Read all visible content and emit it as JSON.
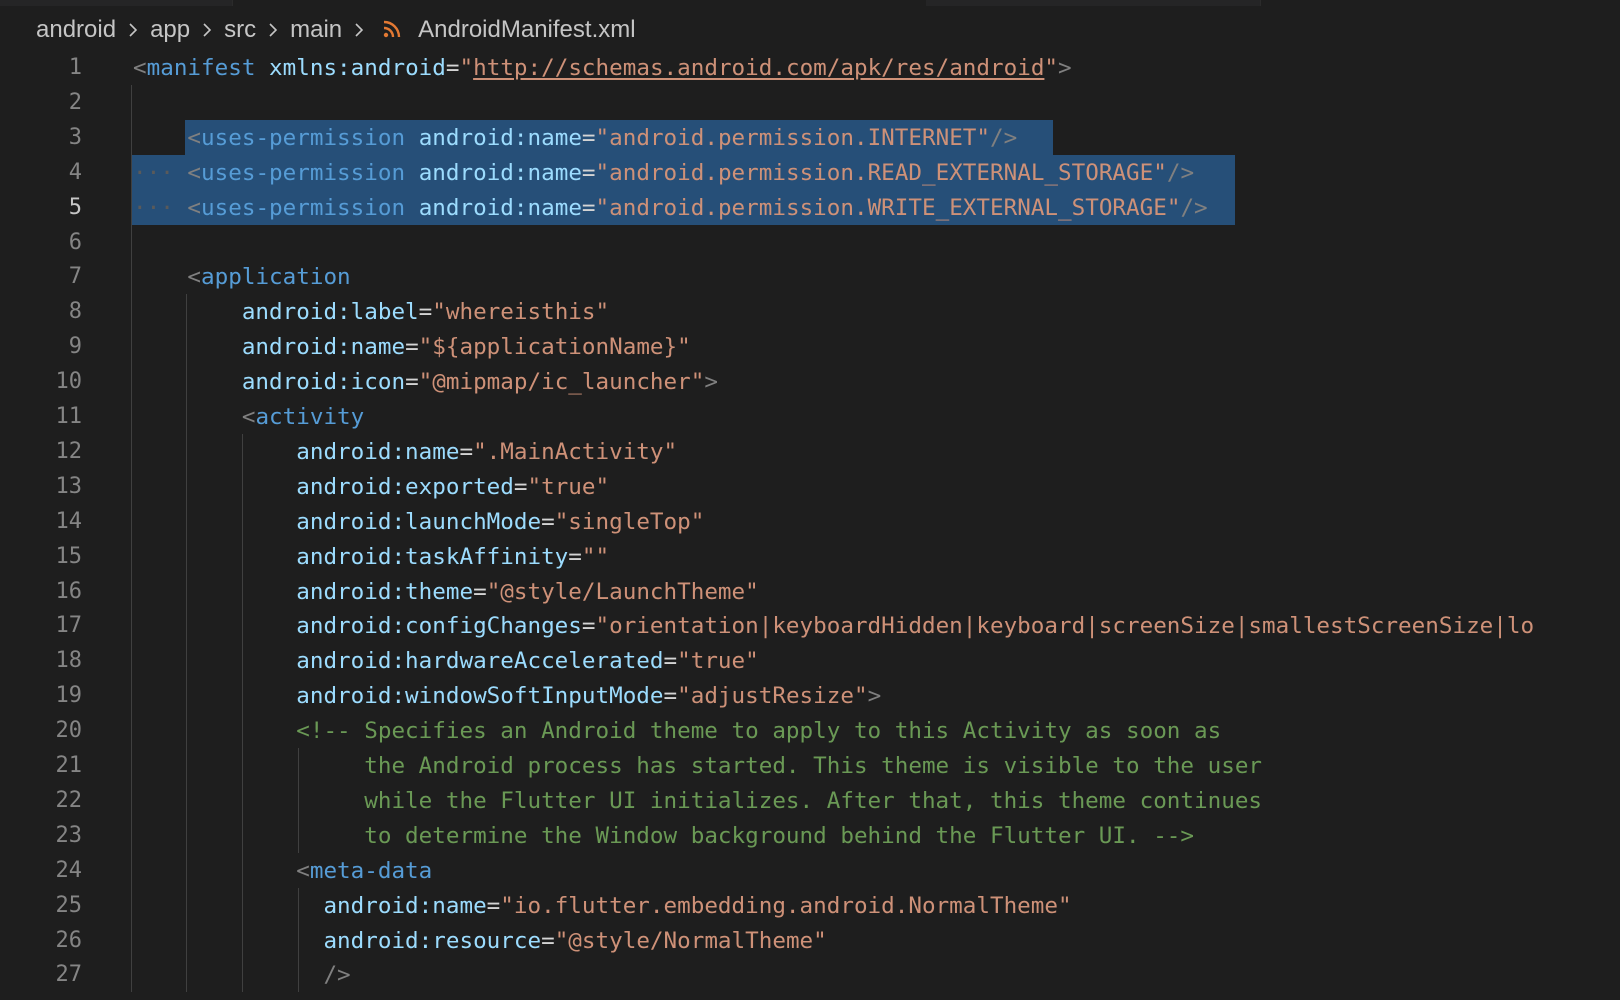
{
  "breadcrumb": {
    "items": [
      "android",
      "app",
      "src",
      "main"
    ],
    "file": "AndroidManifest.xml"
  },
  "editor": {
    "active_line": "5",
    "lines": [
      {
        "n": "1",
        "tokens": [
          [
            "br",
            "<"
          ],
          [
            "tag",
            "manifest"
          ],
          [
            "t",
            " "
          ],
          [
            "attr",
            "xmlns:android"
          ],
          [
            "eq",
            "="
          ],
          [
            "str",
            "\""
          ],
          [
            "url",
            "http://schemas.android.com/apk/res/android"
          ],
          [
            "str",
            "\""
          ],
          [
            "br",
            ">"
          ]
        ]
      },
      {
        "n": "2",
        "tokens": []
      },
      {
        "n": "3",
        "tokens": [
          [
            "t",
            "    "
          ],
          [
            "br",
            "<"
          ],
          [
            "tag",
            "uses-permission"
          ],
          [
            "t",
            " "
          ],
          [
            "attr",
            "android:name"
          ],
          [
            "eq",
            "="
          ],
          [
            "str",
            "\"android.permission.INTERNET\""
          ],
          [
            "br",
            "/>"
          ]
        ]
      },
      {
        "n": "4",
        "tokens": [
          [
            "dot",
            "···"
          ],
          [
            "t",
            " "
          ],
          [
            "br",
            "<"
          ],
          [
            "tag",
            "uses-permission"
          ],
          [
            "t",
            " "
          ],
          [
            "attr",
            "android:name"
          ],
          [
            "eq",
            "="
          ],
          [
            "str",
            "\"android.permission.READ_EXTERNAL_STORAGE\""
          ],
          [
            "br",
            "/>"
          ]
        ]
      },
      {
        "n": "5",
        "tokens": [
          [
            "dot",
            "···"
          ],
          [
            "t",
            " "
          ],
          [
            "br",
            "<"
          ],
          [
            "tag",
            "uses-permission"
          ],
          [
            "t",
            " "
          ],
          [
            "attr",
            "android:name"
          ],
          [
            "eq",
            "="
          ],
          [
            "str",
            "\"android.permission.WRITE_EXTERNAL_STORAGE\""
          ],
          [
            "br",
            "/>"
          ]
        ]
      },
      {
        "n": "6",
        "tokens": []
      },
      {
        "n": "7",
        "tokens": [
          [
            "t",
            "    "
          ],
          [
            "br",
            "<"
          ],
          [
            "tag",
            "application"
          ]
        ]
      },
      {
        "n": "8",
        "tokens": [
          [
            "t",
            "        "
          ],
          [
            "attr",
            "android:label"
          ],
          [
            "eq",
            "="
          ],
          [
            "str",
            "\"whereisthis\""
          ]
        ]
      },
      {
        "n": "9",
        "tokens": [
          [
            "t",
            "        "
          ],
          [
            "attr",
            "android:name"
          ],
          [
            "eq",
            "="
          ],
          [
            "str",
            "\"${applicationName}\""
          ]
        ]
      },
      {
        "n": "10",
        "tokens": [
          [
            "t",
            "        "
          ],
          [
            "attr",
            "android:icon"
          ],
          [
            "eq",
            "="
          ],
          [
            "str",
            "\"@mipmap/ic_launcher\""
          ],
          [
            "br",
            ">"
          ]
        ]
      },
      {
        "n": "11",
        "tokens": [
          [
            "t",
            "        "
          ],
          [
            "br",
            "<"
          ],
          [
            "tag",
            "activity"
          ]
        ]
      },
      {
        "n": "12",
        "tokens": [
          [
            "t",
            "            "
          ],
          [
            "attr",
            "android:name"
          ],
          [
            "eq",
            "="
          ],
          [
            "str",
            "\".MainActivity\""
          ]
        ]
      },
      {
        "n": "13",
        "tokens": [
          [
            "t",
            "            "
          ],
          [
            "attr",
            "android:exported"
          ],
          [
            "eq",
            "="
          ],
          [
            "str",
            "\"true\""
          ]
        ]
      },
      {
        "n": "14",
        "tokens": [
          [
            "t",
            "            "
          ],
          [
            "attr",
            "android:launchMode"
          ],
          [
            "eq",
            "="
          ],
          [
            "str",
            "\"singleTop\""
          ]
        ]
      },
      {
        "n": "15",
        "tokens": [
          [
            "t",
            "            "
          ],
          [
            "attr",
            "android:taskAffinity"
          ],
          [
            "eq",
            "="
          ],
          [
            "str",
            "\"\""
          ]
        ]
      },
      {
        "n": "16",
        "tokens": [
          [
            "t",
            "            "
          ],
          [
            "attr",
            "android:theme"
          ],
          [
            "eq",
            "="
          ],
          [
            "str",
            "\"@style/LaunchTheme\""
          ]
        ]
      },
      {
        "n": "17",
        "tokens": [
          [
            "t",
            "            "
          ],
          [
            "attr",
            "android:configChanges"
          ],
          [
            "eq",
            "="
          ],
          [
            "str",
            "\"orientation|keyboardHidden|keyboard|screenSize|smallestScreenSize|lo"
          ]
        ]
      },
      {
        "n": "18",
        "tokens": [
          [
            "t",
            "            "
          ],
          [
            "attr",
            "android:hardwareAccelerated"
          ],
          [
            "eq",
            "="
          ],
          [
            "str",
            "\"true\""
          ]
        ]
      },
      {
        "n": "19",
        "tokens": [
          [
            "t",
            "            "
          ],
          [
            "attr",
            "android:windowSoftInputMode"
          ],
          [
            "eq",
            "="
          ],
          [
            "str",
            "\"adjustResize\""
          ],
          [
            "br",
            ">"
          ]
        ]
      },
      {
        "n": "20",
        "tokens": [
          [
            "t",
            "            "
          ],
          [
            "com",
            "<!-- Specifies an Android theme to apply to this Activity as soon as"
          ]
        ]
      },
      {
        "n": "21",
        "tokens": [
          [
            "t",
            "                 "
          ],
          [
            "com",
            "the Android process has started. This theme is visible to the user"
          ]
        ]
      },
      {
        "n": "22",
        "tokens": [
          [
            "t",
            "                 "
          ],
          [
            "com",
            "while the Flutter UI initializes. After that, this theme continues"
          ]
        ]
      },
      {
        "n": "23",
        "tokens": [
          [
            "t",
            "                 "
          ],
          [
            "com",
            "to determine the Window background behind the Flutter UI. -->"
          ]
        ]
      },
      {
        "n": "24",
        "tokens": [
          [
            "t",
            "            "
          ],
          [
            "br",
            "<"
          ],
          [
            "tag",
            "meta-data"
          ]
        ]
      },
      {
        "n": "25",
        "tokens": [
          [
            "t",
            "              "
          ],
          [
            "attr",
            "android:name"
          ],
          [
            "eq",
            "="
          ],
          [
            "str",
            "\"io.flutter.embedding.android.NormalTheme\""
          ]
        ]
      },
      {
        "n": "26",
        "tokens": [
          [
            "t",
            "              "
          ],
          [
            "attr",
            "android:resource"
          ],
          [
            "eq",
            "="
          ],
          [
            "str",
            "\"@style/NormalTheme\""
          ]
        ]
      },
      {
        "n": "27",
        "tokens": [
          [
            "t",
            "              "
          ],
          [
            "br",
            "/>"
          ]
        ]
      }
    ]
  },
  "colors": {
    "background": "#1e1e1e",
    "selection": "#264f78",
    "tag": "#569cd6",
    "attribute": "#9cdcfe",
    "string": "#ce9178",
    "comment": "#6a9955",
    "bracket": "#808080",
    "line_number": "#858585"
  }
}
